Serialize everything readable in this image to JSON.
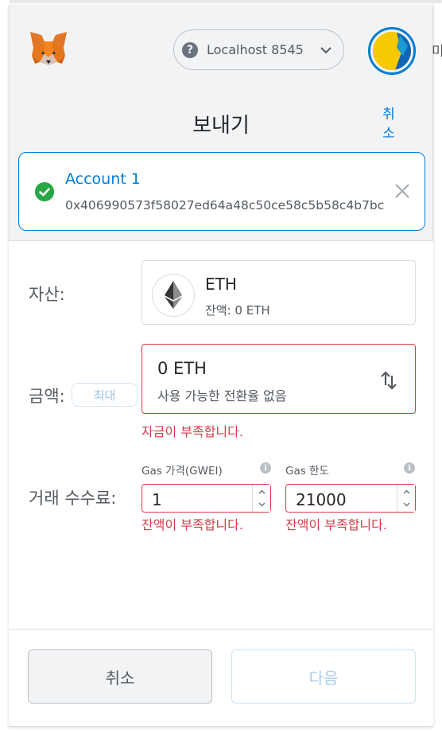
{
  "header": {
    "network_label": "Localhost 8545",
    "right_edge_text": "미"
  },
  "page": {
    "title": "보내기",
    "cancel_link": "취소"
  },
  "recipient": {
    "name": "Account 1",
    "address": "0x406990573f58027ed64a48c50ce58c5b58c4b7bc"
  },
  "asset": {
    "label": "자산:",
    "symbol": "ETH",
    "balance": "잔액: 0 ETH"
  },
  "amount": {
    "label": "금액:",
    "max_label": "최대",
    "value": "0  ETH",
    "conversion_text": "사용 가능한 전환율 없음",
    "error": "자금이 부족합니다."
  },
  "fee": {
    "label": "거래 수수료:",
    "gas_price_label": "Gas 가격(GWEI)",
    "gas_price_value": "1",
    "gas_price_error": "잔액이 부족합니다.",
    "gas_limit_label": "Gas 한도",
    "gas_limit_value": "21000",
    "gas_limit_error": "잔액이 부족합니다."
  },
  "footer": {
    "cancel_label": "취소",
    "next_label": "다음"
  },
  "colors": {
    "accent": "#037dd6",
    "error": "#d73a49",
    "success": "#28a745"
  }
}
